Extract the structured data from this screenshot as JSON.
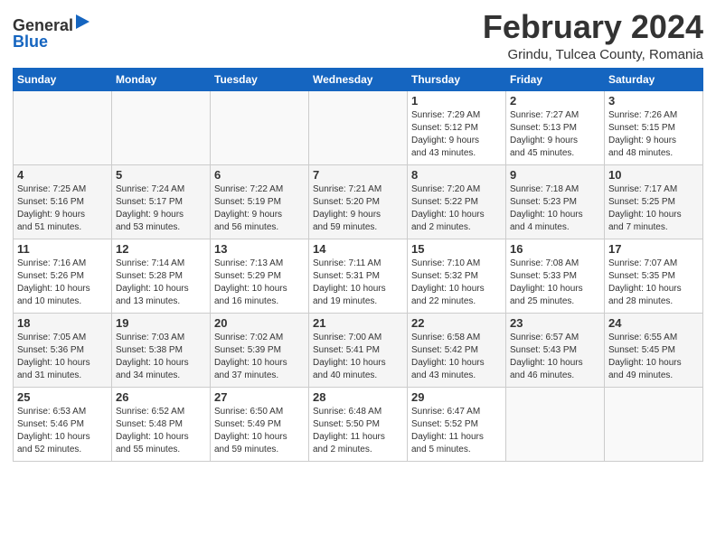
{
  "header": {
    "logo_line1": "General",
    "logo_line2": "Blue",
    "month": "February 2024",
    "location": "Grindu, Tulcea County, Romania"
  },
  "weekdays": [
    "Sunday",
    "Monday",
    "Tuesday",
    "Wednesday",
    "Thursday",
    "Friday",
    "Saturday"
  ],
  "weeks": [
    [
      {
        "day": "",
        "info": ""
      },
      {
        "day": "",
        "info": ""
      },
      {
        "day": "",
        "info": ""
      },
      {
        "day": "",
        "info": ""
      },
      {
        "day": "1",
        "info": "Sunrise: 7:29 AM\nSunset: 5:12 PM\nDaylight: 9 hours\nand 43 minutes."
      },
      {
        "day": "2",
        "info": "Sunrise: 7:27 AM\nSunset: 5:13 PM\nDaylight: 9 hours\nand 45 minutes."
      },
      {
        "day": "3",
        "info": "Sunrise: 7:26 AM\nSunset: 5:15 PM\nDaylight: 9 hours\nand 48 minutes."
      }
    ],
    [
      {
        "day": "4",
        "info": "Sunrise: 7:25 AM\nSunset: 5:16 PM\nDaylight: 9 hours\nand 51 minutes."
      },
      {
        "day": "5",
        "info": "Sunrise: 7:24 AM\nSunset: 5:17 PM\nDaylight: 9 hours\nand 53 minutes."
      },
      {
        "day": "6",
        "info": "Sunrise: 7:22 AM\nSunset: 5:19 PM\nDaylight: 9 hours\nand 56 minutes."
      },
      {
        "day": "7",
        "info": "Sunrise: 7:21 AM\nSunset: 5:20 PM\nDaylight: 9 hours\nand 59 minutes."
      },
      {
        "day": "8",
        "info": "Sunrise: 7:20 AM\nSunset: 5:22 PM\nDaylight: 10 hours\nand 2 minutes."
      },
      {
        "day": "9",
        "info": "Sunrise: 7:18 AM\nSunset: 5:23 PM\nDaylight: 10 hours\nand 4 minutes."
      },
      {
        "day": "10",
        "info": "Sunrise: 7:17 AM\nSunset: 5:25 PM\nDaylight: 10 hours\nand 7 minutes."
      }
    ],
    [
      {
        "day": "11",
        "info": "Sunrise: 7:16 AM\nSunset: 5:26 PM\nDaylight: 10 hours\nand 10 minutes."
      },
      {
        "day": "12",
        "info": "Sunrise: 7:14 AM\nSunset: 5:28 PM\nDaylight: 10 hours\nand 13 minutes."
      },
      {
        "day": "13",
        "info": "Sunrise: 7:13 AM\nSunset: 5:29 PM\nDaylight: 10 hours\nand 16 minutes."
      },
      {
        "day": "14",
        "info": "Sunrise: 7:11 AM\nSunset: 5:31 PM\nDaylight: 10 hours\nand 19 minutes."
      },
      {
        "day": "15",
        "info": "Sunrise: 7:10 AM\nSunset: 5:32 PM\nDaylight: 10 hours\nand 22 minutes."
      },
      {
        "day": "16",
        "info": "Sunrise: 7:08 AM\nSunset: 5:33 PM\nDaylight: 10 hours\nand 25 minutes."
      },
      {
        "day": "17",
        "info": "Sunrise: 7:07 AM\nSunset: 5:35 PM\nDaylight: 10 hours\nand 28 minutes."
      }
    ],
    [
      {
        "day": "18",
        "info": "Sunrise: 7:05 AM\nSunset: 5:36 PM\nDaylight: 10 hours\nand 31 minutes."
      },
      {
        "day": "19",
        "info": "Sunrise: 7:03 AM\nSunset: 5:38 PM\nDaylight: 10 hours\nand 34 minutes."
      },
      {
        "day": "20",
        "info": "Sunrise: 7:02 AM\nSunset: 5:39 PM\nDaylight: 10 hours\nand 37 minutes."
      },
      {
        "day": "21",
        "info": "Sunrise: 7:00 AM\nSunset: 5:41 PM\nDaylight: 10 hours\nand 40 minutes."
      },
      {
        "day": "22",
        "info": "Sunrise: 6:58 AM\nSunset: 5:42 PM\nDaylight: 10 hours\nand 43 minutes."
      },
      {
        "day": "23",
        "info": "Sunrise: 6:57 AM\nSunset: 5:43 PM\nDaylight: 10 hours\nand 46 minutes."
      },
      {
        "day": "24",
        "info": "Sunrise: 6:55 AM\nSunset: 5:45 PM\nDaylight: 10 hours\nand 49 minutes."
      }
    ],
    [
      {
        "day": "25",
        "info": "Sunrise: 6:53 AM\nSunset: 5:46 PM\nDaylight: 10 hours\nand 52 minutes."
      },
      {
        "day": "26",
        "info": "Sunrise: 6:52 AM\nSunset: 5:48 PM\nDaylight: 10 hours\nand 55 minutes."
      },
      {
        "day": "27",
        "info": "Sunrise: 6:50 AM\nSunset: 5:49 PM\nDaylight: 10 hours\nand 59 minutes."
      },
      {
        "day": "28",
        "info": "Sunrise: 6:48 AM\nSunset: 5:50 PM\nDaylight: 11 hours\nand 2 minutes."
      },
      {
        "day": "29",
        "info": "Sunrise: 6:47 AM\nSunset: 5:52 PM\nDaylight: 11 hours\nand 5 minutes."
      },
      {
        "day": "",
        "info": ""
      },
      {
        "day": "",
        "info": ""
      }
    ]
  ]
}
